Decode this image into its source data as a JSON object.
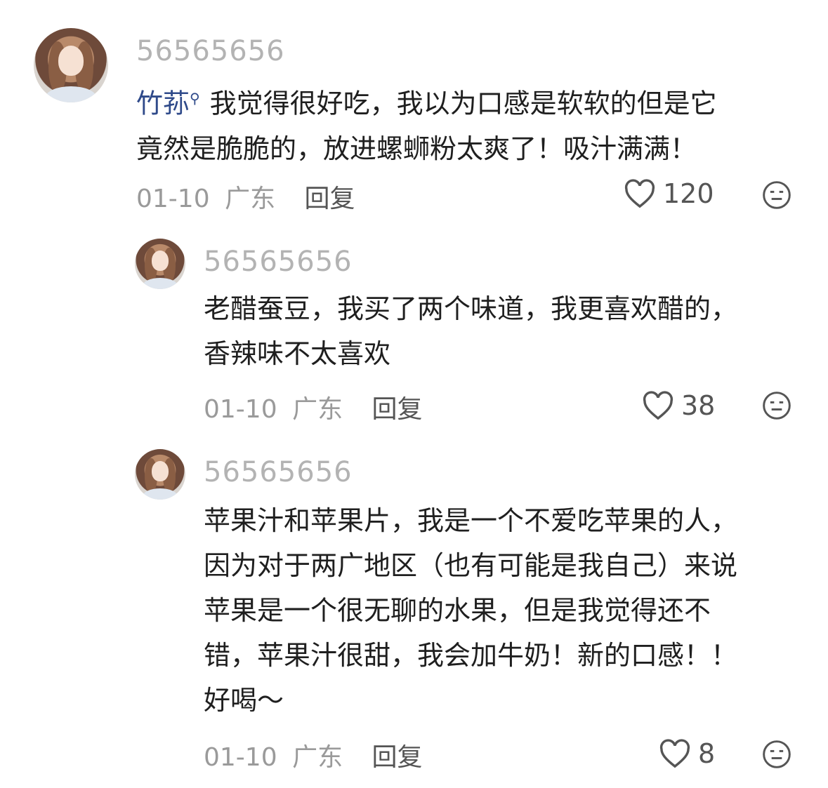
{
  "comments": [
    {
      "username": "56565656",
      "reply_to": "竹荪",
      "text": "我觉得很好吃，我以为口感是软软的但是它\n竟然是脆脆的，放进螺蛳粉太爽了！吸汁满满！",
      "date": "01-10",
      "location": "广东",
      "reply_label": "回复",
      "likes": "120"
    },
    {
      "username": "56565656",
      "text": "老醋蚕豆，我买了两个味道，我更喜欢醋的，\n香辣味不太喜欢",
      "date": "01-10",
      "location": "广东",
      "reply_label": "回复",
      "likes": "38"
    },
    {
      "username": "56565656",
      "text": "苹果汁和苹果片，我是一个不爱吃苹果的人，\n因为对于两广地区（也有可能是我自己）来说\n苹果是一个很无聊的水果，但是我觉得还不\n错，苹果汁很甜，我会加牛奶！新的口感！！\n好喝～",
      "date": "01-10",
      "location": "广东",
      "reply_label": "回复",
      "likes": "8"
    }
  ]
}
